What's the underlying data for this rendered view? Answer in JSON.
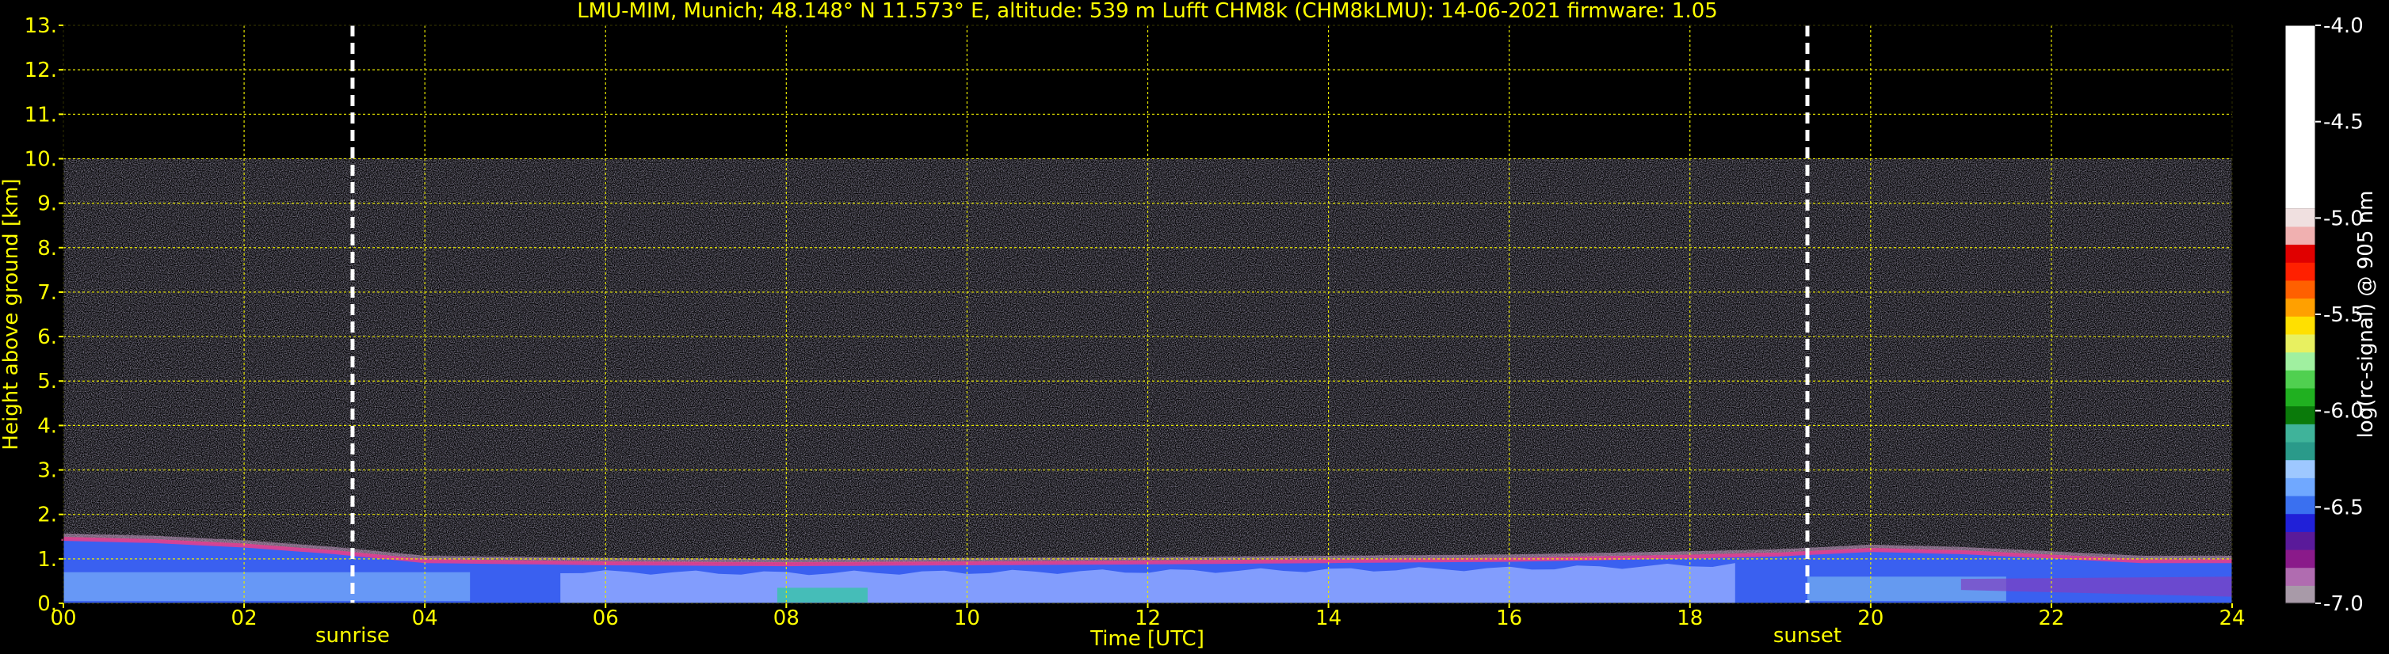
{
  "chart_data": {
    "type": "heatmap",
    "title": "LMU-MIM, Munich; 48.148° N 11.573° E, altitude: 539 m    Lufft CHM8k (CHM8kLMU): 14-06-2021    firmware: 1.05",
    "xlabel": "Time [UTC]",
    "ylabel": "Height above ground [km]",
    "xlim": [
      0,
      24
    ],
    "ylim": [
      0,
      13
    ],
    "x_ticks": [
      0,
      2,
      4,
      6,
      8,
      10,
      12,
      14,
      16,
      18,
      20,
      22,
      24
    ],
    "x_tick_labels": [
      "00",
      "02",
      "04",
      "06",
      "08",
      "10",
      "12",
      "14",
      "16",
      "18",
      "20",
      "22",
      "24"
    ],
    "y_ticks": [
      0,
      1,
      2,
      3,
      4,
      5,
      6,
      7,
      8,
      9,
      10,
      11,
      12,
      13
    ],
    "y_tick_labels": [
      "0.",
      "1.",
      "2.",
      "3.",
      "4.",
      "5.",
      "6.",
      "7.",
      "8.",
      "9.",
      "10.",
      "11.",
      "12.",
      "13."
    ],
    "grid": true,
    "data_ceiling_km": 10,
    "annotations": [
      {
        "label": "sunrise",
        "x": 3.2
      },
      {
        "label": "sunset",
        "x": 19.3
      }
    ],
    "boundary_layer": {
      "x": [
        0,
        1,
        2,
        3,
        4,
        6,
        8,
        10,
        12,
        14,
        16,
        18,
        19,
        20,
        21,
        22,
        23,
        24
      ],
      "top_km": [
        1.45,
        1.4,
        1.3,
        1.15,
        0.95,
        0.9,
        0.88,
        0.9,
        0.92,
        0.95,
        0.98,
        1.05,
        1.1,
        1.2,
        1.15,
        1.05,
        0.95,
        0.95
      ]
    },
    "colorbar": {
      "label": "log(rc-signal) @ 905 nm",
      "range": [
        -7.0,
        -4.0
      ],
      "ticks": [
        -4.0,
        -4.5,
        -5.0,
        -5.5,
        -6.0,
        -6.5,
        -7.0
      ],
      "tick_labels": [
        "-4.0",
        "-4.5",
        "-5.0",
        "-5.5",
        "-6.0",
        "-6.5",
        "-7.0"
      ],
      "colors": [
        "#a89aa8",
        "#b06cb0",
        "#8a1a8a",
        "#5a1a9a",
        "#2020d8",
        "#3a70f0",
        "#70a8ff",
        "#9ec8ff",
        "#2a9a8a",
        "#3fb39a",
        "#0a7a0a",
        "#20b020",
        "#50d050",
        "#a0f0a0",
        "#e8f060",
        "#ffe000",
        "#ffa000",
        "#ff6000",
        "#ff2000",
        "#e00000",
        "#f0b0b0",
        "#f0e0e0",
        "#ffffff"
      ]
    }
  }
}
